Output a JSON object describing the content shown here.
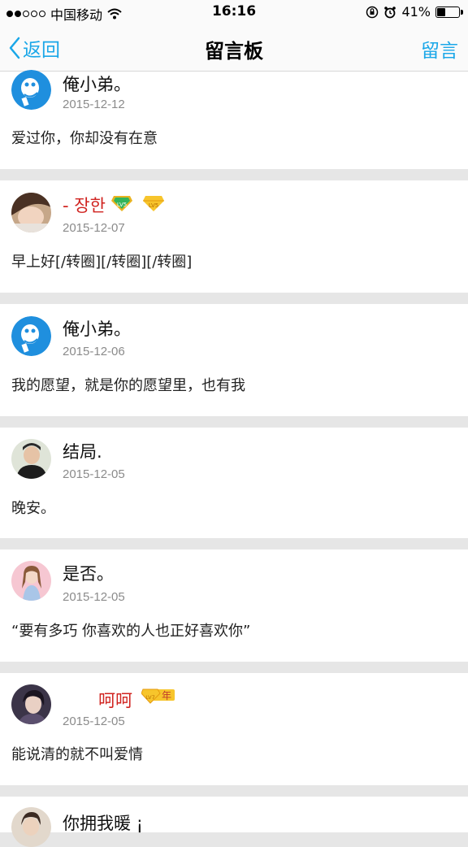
{
  "status_bar": {
    "carrier": "中国移动",
    "time": "16:16",
    "battery_text": "41%",
    "battery_level": 0.41
  },
  "nav": {
    "back_label": "返回",
    "title": "留言板",
    "action_label": "留言"
  },
  "messages": [
    {
      "name": "俺小弟。",
      "date": "2015-12-12",
      "content": "爱过你，你却没有在意",
      "avatar_icon": "blue-cartoon-avatar"
    },
    {
      "name": "- 장한",
      "date": "2015-12-07",
      "content": "早上好[/转圈][/转圈][/转圈]",
      "avatar_icon": "photo-avatar",
      "badges": [
        "lv5-green-badge-icon",
        "lv5-diamond-badge-icon"
      ]
    },
    {
      "name": "俺小弟。",
      "date": "2015-12-06",
      "content": "我的愿望，就是你的愿望里，也有我",
      "avatar_icon": "blue-cartoon-avatar"
    },
    {
      "name": "结局.",
      "date": "2015-12-05",
      "content": "晚安。",
      "avatar_icon": "photo-avatar"
    },
    {
      "name": "是否。",
      "date": "2015-12-05",
      "content": "“要有多巧 你喜欢的人也正好喜欢你”",
      "avatar_icon": "photo-avatar"
    },
    {
      "name": "呵呵",
      "date": "2015-12-05",
      "content": "能说清的就不叫爱情",
      "avatar_icon": "photo-avatar",
      "badges": [
        "lv7-year-diamond-badge-icon"
      ],
      "badge_text": "年"
    },
    {
      "name": "你拥我暖 ¡",
      "date": "",
      "content": "",
      "avatar_icon": "photo-avatar"
    }
  ],
  "colors": {
    "accent": "#1aa7e8",
    "vip_name": "#d0231f",
    "date": "#8b8b8b",
    "separator": "#e6e6e6"
  }
}
